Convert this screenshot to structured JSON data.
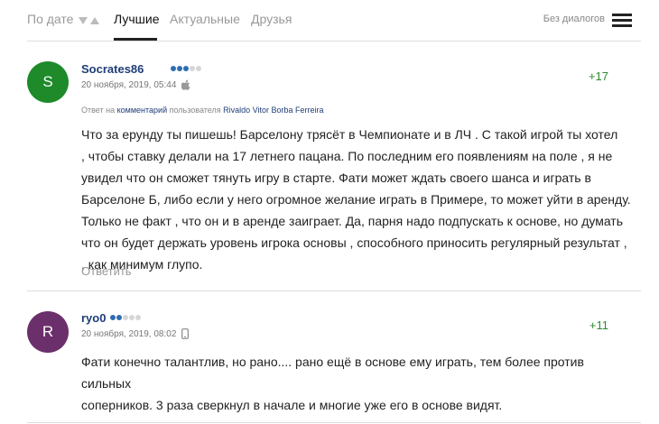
{
  "tabs": {
    "by_date": "По дате",
    "best": "Лучшие",
    "actual": "Актуальные",
    "friends": "Друзья",
    "no_dialogs": "Без диалогов"
  },
  "colors": {
    "accent": "#1f3d77",
    "positive": "#2e8b2e",
    "avatar_s": "#1e8a2a",
    "avatar_r": "#6b2f6b",
    "rating_dot": "#2f6db3"
  },
  "comments": [
    {
      "avatar_letter": "S",
      "username": "Socrates86",
      "rating_dots_on": 3,
      "rating_dots_total": 5,
      "timestamp": "20 ноября, 2019, 05:44",
      "device_icon": "apple-icon",
      "score": "+17",
      "reply_prefix": "Ответ на",
      "reply_link": "комментарий",
      "reply_mid": "пользователя",
      "reply_user": "Rivaldo Vitor Borba Ferreira",
      "text_lines": [
        "Что за ерунду ты пишешь! Барселону трясёт в Чемпионате и в ЛЧ . С такой игрой ты хотел",
        ", чтобы ставку делали на 17 летнего пацана. По последним его появлениям на поле , я не",
        "увидел что он сможет тянуть игру в старте. Фати может ждать своего шанса и играть в",
        "Барселоне Б, либо если у него огромное желание играть в Примере, то может уйти в аренду.",
        "Только не факт , что он и в аренде заиграет. Да, парня надо подпускать к основе, но думать",
        "что он будет держать уровень игрока основы , способного приносить регулярный результат ,",
        ", как минимум глупо."
      ],
      "reply_label": "Ответить"
    },
    {
      "avatar_letter": "R",
      "username": "ryo0",
      "rating_dots_on": 2,
      "rating_dots_total": 5,
      "timestamp": "20 ноября, 2019, 08:02",
      "device_icon": "phone-icon",
      "score": "+11",
      "text_lines": [
        "Фати конечно талантлив, но рано.... рано ещё в основе ему играть, тем более против сильных",
        "соперников. 3 раза сверкнул в начале и многие уже его в основе видят."
      ]
    }
  ]
}
